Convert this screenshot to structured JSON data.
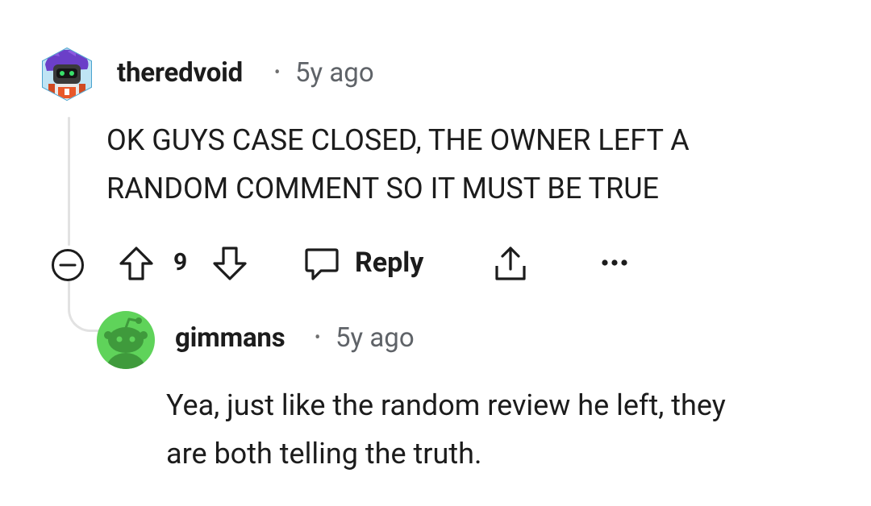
{
  "comment": {
    "username": "theredvoid",
    "separator": "•",
    "time": "5y ago",
    "body_line1": "OK GUYS CASE CLOSED, THE OWNER LEFT A",
    "body_line2": "RANDOM COMMENT SO IT MUST BE TRUE",
    "score": "9",
    "reply_label": "Reply",
    "avatar_icon": "custom-avatar-icon",
    "colors": {
      "text": "#1c1c1c",
      "muted": "#5f6368",
      "thread_line": "#e2e2e2"
    }
  },
  "reply": {
    "username": "gimmans",
    "separator": "•",
    "time": "5y ago",
    "body_line1": "Yea, just like the random review he left, they",
    "body_line2": "are both telling the truth.",
    "avatar_icon": "default-snoo-avatar-icon",
    "avatar_bg": "#5fd35a"
  },
  "icons": {
    "collapse": "collapse-minus-icon",
    "upvote": "upvote-arrow-icon",
    "downvote": "downvote-arrow-icon",
    "reply": "speech-bubble-icon",
    "share": "share-icon",
    "more": "more-options-icon"
  }
}
